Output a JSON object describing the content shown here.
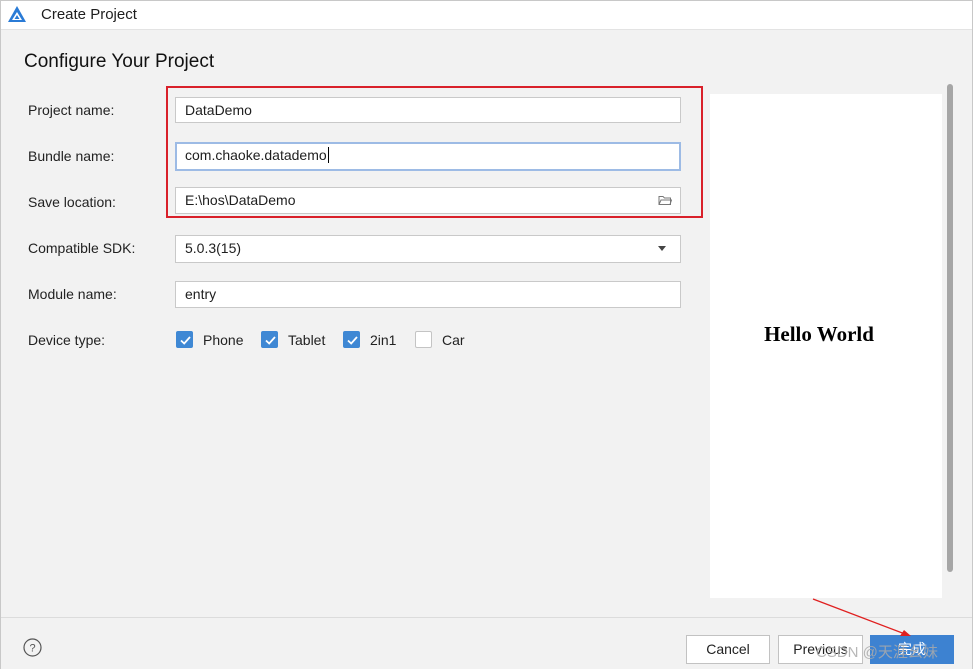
{
  "window": {
    "title": "Create Project"
  },
  "page": {
    "heading": "Configure Your Project"
  },
  "form": {
    "project_name": {
      "label": "Project name:",
      "value": "DataDemo"
    },
    "bundle_name": {
      "label": "Bundle name:",
      "value": "com.chaoke.datademo"
    },
    "save_location": {
      "label": "Save location:",
      "value": "E:\\hos\\DataDemo"
    },
    "compatible_sdk": {
      "label": "Compatible SDK:",
      "value": "5.0.3(15)"
    },
    "module_name": {
      "label": "Module name:",
      "value": "entry"
    },
    "device_type": {
      "label": "Device type:",
      "options": [
        {
          "label": "Phone",
          "checked": true
        },
        {
          "label": "Tablet",
          "checked": true
        },
        {
          "label": "2in1",
          "checked": true
        },
        {
          "label": "Car",
          "checked": false
        }
      ]
    }
  },
  "preview": {
    "text": "Hello World"
  },
  "footer": {
    "cancel_label": "Cancel",
    "previous_label": "Previous",
    "finish_label": "完成"
  },
  "watermark": {
    "text": "CSDN @天涯幺妹"
  },
  "colors": {
    "accent": "#3d82d1",
    "highlight_box": "#d9202a",
    "checkbox_checked": "#3f88d4"
  },
  "icons": {
    "app": "app-logo-icon",
    "folder": "folder-icon",
    "dropdown": "chevron-down-icon",
    "help": "help-icon",
    "check": "check-icon"
  }
}
